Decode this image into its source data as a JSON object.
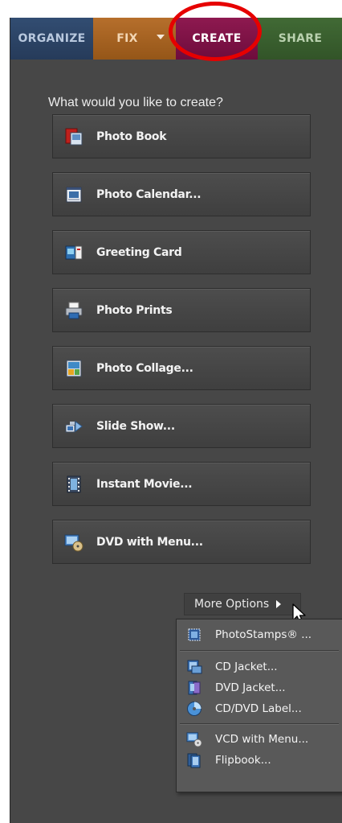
{
  "tabs": {
    "organize": "ORGANIZE",
    "fix": "FIX",
    "create": "CREATE",
    "share": "SHARE",
    "selected": "create"
  },
  "create_panel": {
    "prompt": "What would you like to create?",
    "buttons": [
      {
        "label": "Photo Book",
        "icon": "photo-book-icon"
      },
      {
        "label": "Photo Calendar...",
        "icon": "calendar-icon"
      },
      {
        "label": "Greeting Card",
        "icon": "greeting-card-icon"
      },
      {
        "label": "Photo Prints",
        "icon": "printer-icon"
      },
      {
        "label": "Photo Collage...",
        "icon": "collage-icon"
      },
      {
        "label": "Slide Show...",
        "icon": "slideshow-icon"
      },
      {
        "label": "Instant Movie...",
        "icon": "film-icon"
      },
      {
        "label": "DVD with Menu...",
        "icon": "dvd-menu-icon"
      }
    ],
    "more_options": "More Options"
  },
  "more_menu": {
    "items": [
      {
        "label": "PhotoStamps® ...",
        "icon": "stamp-icon"
      },
      {
        "label": "CD Jacket...",
        "icon": "cd-jacket-icon"
      },
      {
        "label": "DVD Jacket...",
        "icon": "dvd-jacket-icon"
      },
      {
        "label": "CD/DVD Label...",
        "icon": "disc-label-icon"
      },
      {
        "label": "VCD with Menu...",
        "icon": "vcd-menu-icon"
      },
      {
        "label": "Flipbook...",
        "icon": "flipbook-icon"
      }
    ]
  },
  "colors": {
    "panel_bg": "#474747",
    "organize_tab": "#2c4566",
    "fix_tab": "#a76322",
    "create_tab": "#7e1246",
    "share_tab": "#3a5f2e",
    "annotation_circle": "#e60000"
  }
}
